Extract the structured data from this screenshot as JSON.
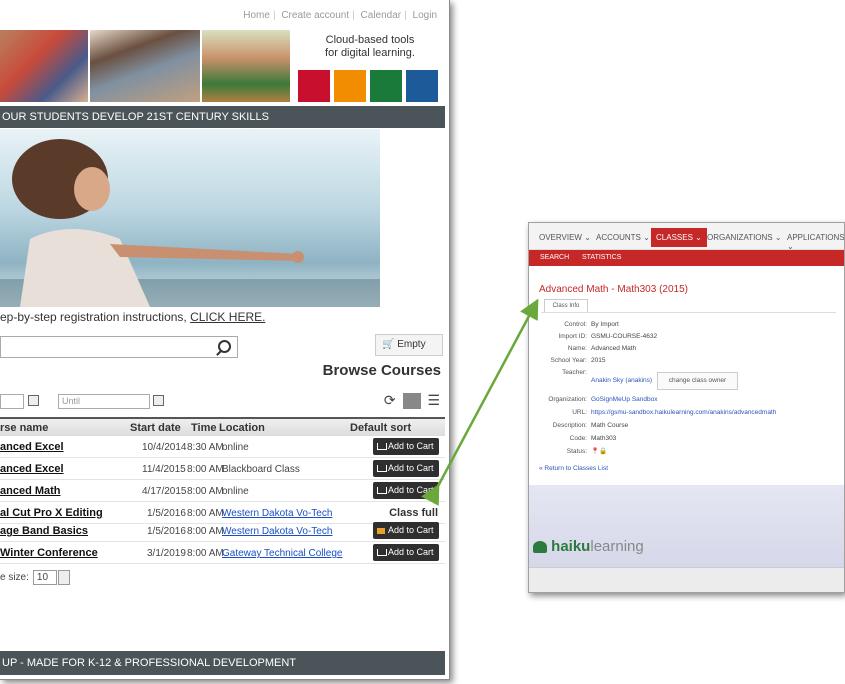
{
  "left": {
    "topnav": [
      "Home",
      "Create account",
      "Calendar",
      "Login"
    ],
    "tagline_line1": "Cloud-based tools",
    "tagline_line2": "for digital learning.",
    "tile_colors": [
      "#c8102e",
      "#f28c00",
      "#1a7a3a",
      "#1c5a9a"
    ],
    "banner_top": "OUR STUDENTS DEVELOP 21ST CENTURY SKILLS",
    "registration_text": "ep-by-step registration instructions, ",
    "registration_link": "CLICK HERE.",
    "cart_label": "Empty",
    "browse_title": "Browse Courses",
    "until_placeholder": "Until",
    "headers": {
      "course": "rse name",
      "start": "Start date",
      "time": "Time",
      "location": "Location",
      "sort": "Default sort"
    },
    "rows": [
      {
        "name": "anced Excel",
        "date": "10/4/2014",
        "time": "8:30 AM",
        "location": "online",
        "loc_link": "",
        "action": "Add to Cart"
      },
      {
        "name": "anced Excel",
        "date": "11/4/2015",
        "time": "8:00 AM",
        "location": "Blackboard Class",
        "loc_link": "",
        "action": "Add to Cart"
      },
      {
        "name": "anced Math",
        "date": "4/17/2015",
        "time": "8:00 AM",
        "location": "online",
        "loc_link": "",
        "action": "Add to Cart"
      },
      {
        "name": "al Cut Pro X Editing",
        "date": "1/5/2016",
        "time": "8:00 AM",
        "location": "",
        "loc_link": "Western Dakota Vo-Tech",
        "action": "Class full"
      },
      {
        "name": "age Band Basics",
        "date": "1/5/2016",
        "time": "8:00 AM",
        "location": "",
        "loc_link": "Western Dakota Vo-Tech",
        "action": "Add to Cart"
      },
      {
        "name": "Winter Conference",
        "date": "3/1/2019",
        "time": "8:00 AM",
        "location": "",
        "loc_link": "Gateway Technical College",
        "action": "Add to Cart"
      }
    ],
    "page_size_label": "e size:",
    "page_size_value": "10",
    "banner_bottom": "UP - MADE FOR K-12 & PROFESSIONAL DEVELOPMENT"
  },
  "right": {
    "nav": [
      "OVERVIEW ⌄",
      "ACCOUNTS ⌄",
      "CLASSES ⌄",
      "ORGANIZATIONS ⌄",
      "APPLICATIONS ⌄"
    ],
    "subnav": [
      "SEARCH",
      "STATISTICS"
    ],
    "title": "Advanced Math - Math303 (2015)",
    "tab": "Class Info",
    "fields": {
      "control_k": "Control:",
      "control_v": "By Import",
      "import_k": "Import ID:",
      "import_v": "GSMU-COURSE-4632",
      "name_k": "Name:",
      "name_v": "Advanced Math",
      "year_k": "School Year:",
      "year_v": "2015",
      "teacher_k": "Teacher:",
      "teacher_v": "Anakin Sky (anakins)",
      "change_owner": "change class owner",
      "org_k": "Organization:",
      "org_v": "GoSignMeUp Sandbox",
      "url_k": "URL:",
      "url_v": "https://gsmu-sandbox.haikulearning.com/anakins/advancedmath",
      "desc_k": "Description:",
      "desc_v": "Math Course",
      "code_k": "Code:",
      "code_v": "Math303",
      "status_k": "Status:"
    },
    "back_link": "« Return to Classes List",
    "logo_bold": "haiku",
    "logo_light": "learning"
  },
  "colors": {
    "accent_red": "#c62828",
    "banner_gray": "#4b5459",
    "arrow_green": "#6aa83b"
  }
}
